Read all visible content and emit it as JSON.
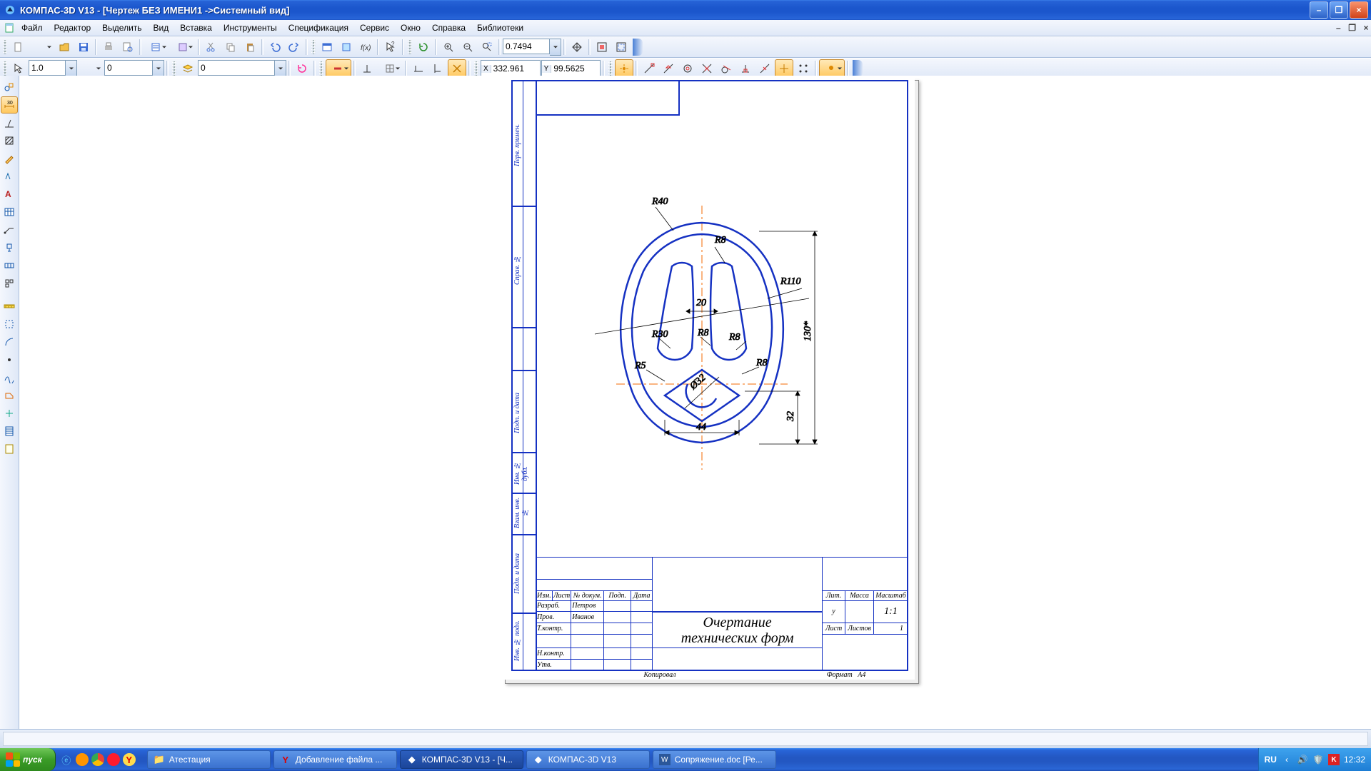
{
  "window": {
    "title": "КОМПАС-3D V13 - [Чертеж БЕЗ ИМЕНИ1 ->Системный вид]"
  },
  "menu": {
    "file": "Файл",
    "edit": "Редактор",
    "select": "Выделить",
    "view": "Вид",
    "insert": "Вставка",
    "tools": "Инструменты",
    "spec": "Спецификация",
    "service": "Сервис",
    "window": "Окно",
    "help": "Справка",
    "libs": "Библиотеки"
  },
  "toolbar1": {
    "zoom_value": "0.7494"
  },
  "toolbar2": {
    "step": "1.0",
    "val_b": "0",
    "val_c": "0",
    "coord_label_x": "X",
    "coord_label_y": "Y",
    "coord_x": "332.961",
    "coord_y": "99.5625"
  },
  "drawing": {
    "title_line1": "Очертание",
    "title_line2": "технических форм",
    "stamp": {
      "hdr_izm": "Изм.",
      "hdr_list": "Лист",
      "hdr_ndoc": "№ докум.",
      "hdr_podp": "Подп.",
      "hdr_data": "Дата",
      "row_razrab": "Разраб.",
      "row_prov": "Пров.",
      "row_tkontr": "Т.контр.",
      "row_nkontr": "Н.контр.",
      "row_utv": "Утв.",
      "name_petrov": "Петров",
      "name_ivanov": "Иванов",
      "lit": "Лит.",
      "massa": "Масса",
      "masshtab": "Масштаб",
      "lit_val": "у",
      "scale": "1:1",
      "list": "Лист",
      "listov": "Листов",
      "listov_val": "1",
      "kopiroval": "Копировал",
      "format": "Формат",
      "format_val": "А4"
    },
    "sidecells": {
      "a": "Перв. примен.",
      "b": "Справ. №",
      "c": "Подп. и дата",
      "d": "Инв. № дубл.",
      "e": "Взам. инв. №",
      "f": "Подп. и дата",
      "g": "Инв. № подл."
    },
    "dims": {
      "r40": "R40",
      "r8a": "R8",
      "r8b": "R8",
      "r8c": "R8",
      "r8d": "R8",
      "r110": "R110",
      "r30": "R30",
      "r5": "R5",
      "d20": "20",
      "d44": "44",
      "d130": "130*",
      "d32": "32",
      "dia32": "Ø32"
    }
  },
  "taskbar": {
    "start": "пуск",
    "items": [
      {
        "icon": "folder",
        "label": "Атестация"
      },
      {
        "icon": "yandex",
        "label": "Добавление файла ..."
      },
      {
        "icon": "kompas",
        "label": "КОМПАС-3D V13 - [Ч..."
      },
      {
        "icon": "kompas",
        "label": "КОМПАС-3D V13"
      },
      {
        "icon": "word",
        "label": "Сопряжение.doc [Ре..."
      }
    ],
    "lang": "RU",
    "clock": "12:32"
  }
}
